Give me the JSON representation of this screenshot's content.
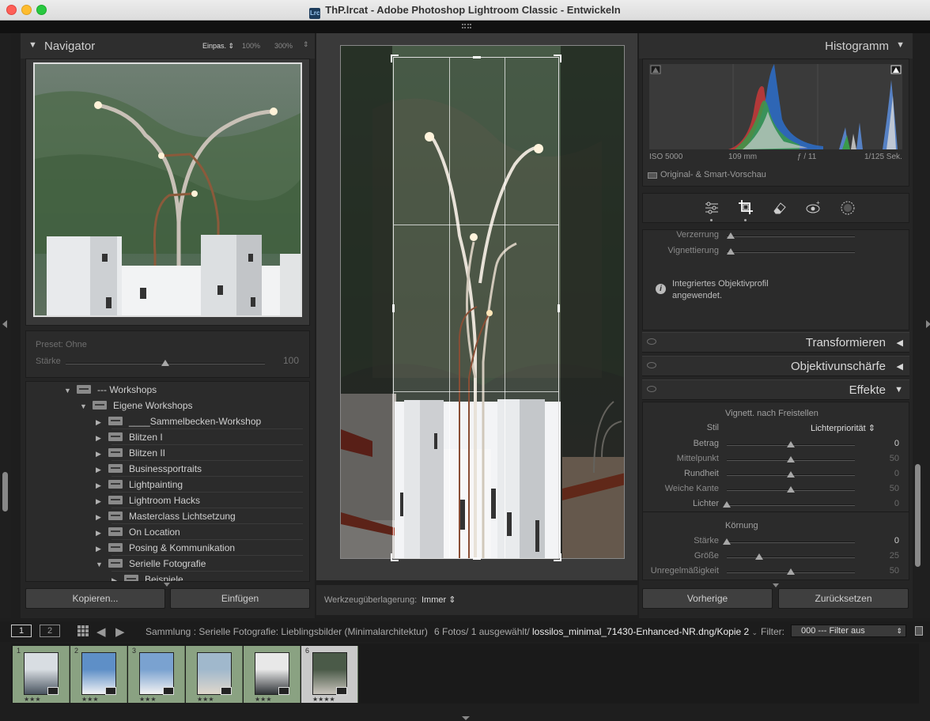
{
  "window": {
    "title": "ThP.lrcat - Adobe Photoshop Lightroom Classic - Entwickeln",
    "app_badge": "Lrc"
  },
  "navigator": {
    "title": "Navigator",
    "zoom_fit": "Einpas.",
    "zoom_100": "100%",
    "zoom_300": "300%"
  },
  "preset": {
    "label": "Preset: Ohne",
    "amount_label": "Stärke",
    "amount_value": "100",
    "amount_fraction": 0.5
  },
  "folders": [
    {
      "label": "--- Workshops",
      "level": 0,
      "expanded": true
    },
    {
      "label": "Eigene Workshops",
      "level": 1,
      "expanded": true
    },
    {
      "label": "____Sammelbecken-Workshop",
      "level": 2,
      "expanded": false
    },
    {
      "label": "Blitzen I",
      "level": 2,
      "expanded": false
    },
    {
      "label": "Blitzen II",
      "level": 2,
      "expanded": false
    },
    {
      "label": "Businessportraits",
      "level": 2,
      "expanded": false
    },
    {
      "label": "Lightpainting",
      "level": 2,
      "expanded": false
    },
    {
      "label": "Lightroom Hacks",
      "level": 2,
      "expanded": false
    },
    {
      "label": "Masterclass Lichtsetzung",
      "level": 2,
      "expanded": false
    },
    {
      "label": "On Location",
      "level": 2,
      "expanded": false
    },
    {
      "label": "Posing & Kommunikation",
      "level": 2,
      "expanded": false
    },
    {
      "label": "Serielle Fotografie",
      "level": 2,
      "expanded": true
    },
    {
      "label": "Beispiele",
      "level": 3,
      "expanded": false
    }
  ],
  "left_buttons": {
    "copy": "Kopieren...",
    "paste": "Einfügen"
  },
  "toolbar": {
    "overlay_label": "Werkzeugüberlagerung:",
    "overlay_value": "Immer"
  },
  "histogram": {
    "title": "Histogramm",
    "iso": "ISO 5000",
    "focal": "109 mm",
    "aperture": "ƒ / 11",
    "shutter": "1/125 Sek.",
    "preview_label": "Original- & Smart-Vorschau"
  },
  "tools": [
    "sliders-icon",
    "crop-icon",
    "eraser-icon",
    "redeye-icon",
    "mask-icon"
  ],
  "lens": {
    "distortion_label": "Verzerrung",
    "vignetting_label": "Vignettierung",
    "info_text_1": "Integriertes Objektivprofil",
    "info_text_2": "angewendet."
  },
  "sections": {
    "transform": "Transformieren",
    "sharpness": "Objektivunschärfe",
    "effects": "Effekte"
  },
  "effects": {
    "vignette_title": "Vignett. nach Freistellen",
    "style_label": "Stil",
    "style_value": "Lichterpriorität",
    "sliders": [
      {
        "label": "Betrag",
        "value": "0",
        "fraction": 0.5
      },
      {
        "label": "Mittelpunkt",
        "value": "50",
        "fraction": 0.5
      },
      {
        "label": "Rundheit",
        "value": "0",
        "fraction": 0.5
      },
      {
        "label": "Weiche Kante",
        "value": "50",
        "fraction": 0.5
      },
      {
        "label": "Lichter",
        "value": "0",
        "fraction": 0.0
      }
    ],
    "grain_title": "Körnung",
    "grain_sliders": [
      {
        "label": "Stärke",
        "value": "0",
        "fraction": 0.0
      },
      {
        "label": "Größe",
        "value": "25",
        "fraction": 0.25
      },
      {
        "label": "Unregelmäßigkeit",
        "value": "50",
        "fraction": 0.5
      }
    ]
  },
  "right_buttons": {
    "previous": "Vorherige",
    "reset": "Zurücksetzen"
  },
  "filmstrip_bar": {
    "view1": "1",
    "view2": "2",
    "source": "Sammlung : Serielle Fotografie: Lieblingsbilder (Minimalarchitektur)",
    "count": "6 Fotos/ 1 ausgewählt/",
    "filename": "lossilos_minimal_71430-Enhanced-NR.dng/Kopie 2",
    "filter_label": "Filter:",
    "filter_value": "000 --- Filter aus"
  },
  "filmstrip": [
    {
      "num": "1",
      "stars": "★★★"
    },
    {
      "num": "2",
      "stars": "★★★"
    },
    {
      "num": "3",
      "stars": "★★★"
    },
    {
      "num": "",
      "stars": "★★★"
    },
    {
      "num": "",
      "stars": "★★★"
    },
    {
      "num": "6",
      "stars": "★★★★"
    }
  ]
}
